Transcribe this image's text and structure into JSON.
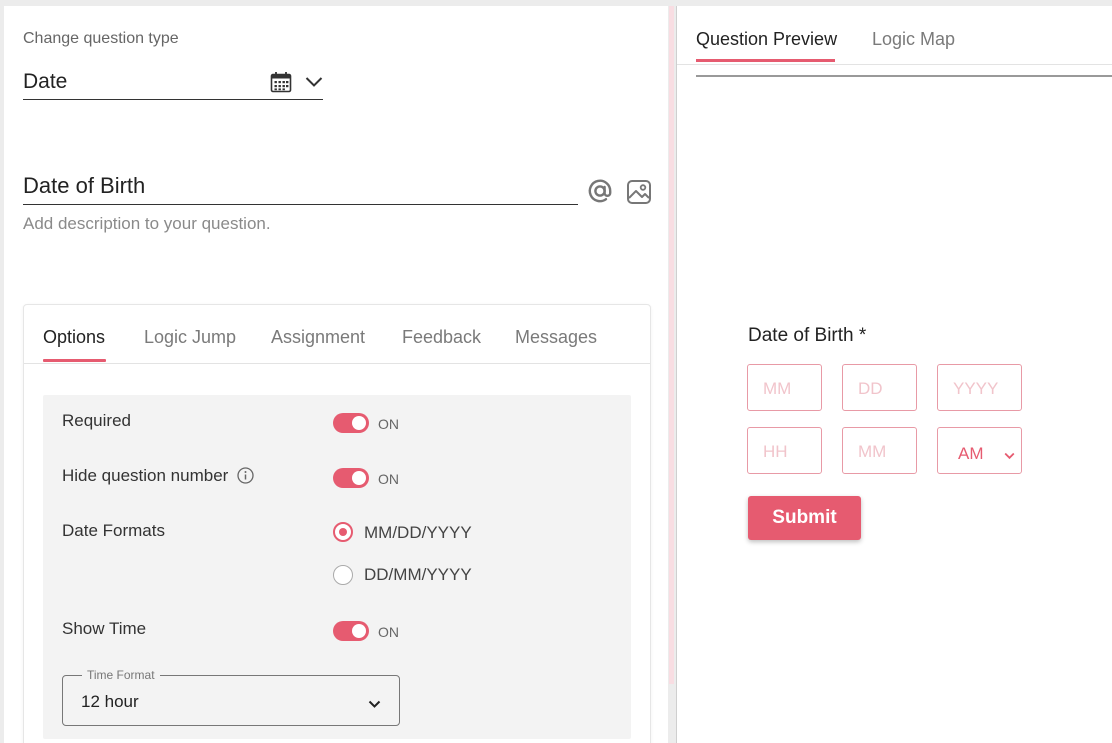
{
  "editor": {
    "question_type_label": "Change question type",
    "question_type_value": "Date",
    "question_title": "Date of Birth",
    "description_placeholder": "Add description to your question."
  },
  "settings_tabs": [
    "Options",
    "Logic Jump",
    "Assignment",
    "Feedback",
    "Messages"
  ],
  "options": {
    "required_label": "Required",
    "required_state": "ON",
    "hide_number_label": "Hide question number",
    "hide_number_state": "ON",
    "date_formats_label": "Date Formats",
    "date_format_1": "MM/DD/YYYY",
    "date_format_2": "DD/MM/YYYY",
    "show_time_label": "Show Time",
    "show_time_state": "ON",
    "time_format_label": "Time Format",
    "time_format_value": "12 hour"
  },
  "preview_tabs": [
    "Question Preview",
    "Logic Map"
  ],
  "preview": {
    "question_title": "Date of Birth *",
    "date_placeholders": [
      "MM",
      "DD",
      "YYYY"
    ],
    "time_placeholders": [
      "HH",
      "MM"
    ],
    "ampm_value": "AM",
    "submit_label": "Submit"
  },
  "colors": {
    "accent": "#e65b70",
    "input_border": "#e89aa6",
    "placeholder": "#f1c4cb"
  }
}
